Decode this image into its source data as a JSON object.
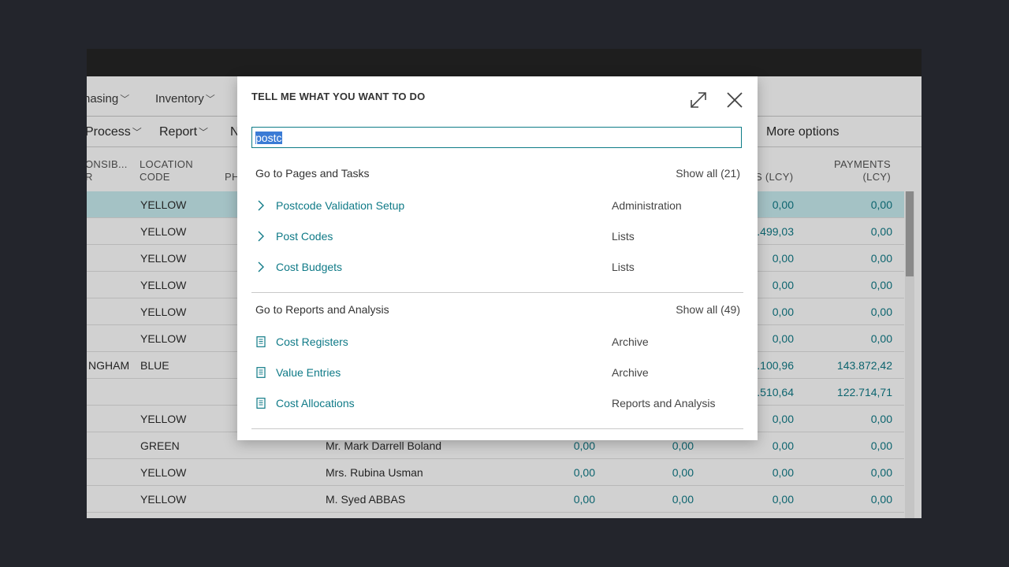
{
  "menu_row": [
    {
      "label": "hasing"
    },
    {
      "label": "Inventory"
    }
  ],
  "action_row": {
    "process": "Process",
    "report": "Report",
    "n_partial": "N",
    "more_options": "More options"
  },
  "columns": {
    "responsible": "ONSIB...\nR",
    "location_code": "LOCATION\nCODE",
    "phone_partial": "PH",
    "sales_partial": "S (LCY)",
    "payments": "PAYMENTS\n(LCY)"
  },
  "rows": [
    {
      "responsible": "",
      "location": "YELLOW",
      "contact": "",
      "c1": "",
      "c2": "",
      "c3": "0,00",
      "payments": "0,00",
      "selected": true
    },
    {
      "responsible": "",
      "location": "YELLOW",
      "contact": "",
      "c1": "",
      "c2": "",
      "c3": ".499,03",
      "payments": "0,00"
    },
    {
      "responsible": "",
      "location": "YELLOW",
      "contact": "",
      "c1": "",
      "c2": "",
      "c3": "0,00",
      "payments": "0,00"
    },
    {
      "responsible": "",
      "location": "YELLOW",
      "contact": "",
      "c1": "",
      "c2": "",
      "c3": "0,00",
      "payments": "0,00"
    },
    {
      "responsible": "",
      "location": "YELLOW",
      "contact": "",
      "c1": "",
      "c2": "",
      "c3": "0,00",
      "payments": "0,00"
    },
    {
      "responsible": "",
      "location": "YELLOW",
      "contact": "",
      "c1": "",
      "c2": "",
      "c3": "0,00",
      "payments": "0,00"
    },
    {
      "responsible": "NGHAM",
      "location": "BLUE",
      "contact": "",
      "c1": "",
      "c2": "",
      "c3": ".100,96",
      "payments": "143.872,42"
    },
    {
      "responsible": "",
      "location": "",
      "contact": "",
      "c1": "",
      "c2": "",
      "c3": ".510,64",
      "payments": "122.714,71"
    },
    {
      "responsible": "",
      "location": "YELLOW",
      "contact": "",
      "c1": "",
      "c2": "",
      "c3": "0,00",
      "payments": "0,00"
    },
    {
      "responsible": "",
      "location": "GREEN",
      "contact": "Mr. Mark Darrell Boland",
      "c1": "0,00",
      "c2": "0,00",
      "c3": "0,00",
      "payments": "0,00"
    },
    {
      "responsible": "",
      "location": "YELLOW",
      "contact": "Mrs. Rubina Usman",
      "c1": "0,00",
      "c2": "0,00",
      "c3": "0,00",
      "payments": "0,00"
    },
    {
      "responsible": "",
      "location": "YELLOW",
      "contact": "M. Syed ABBAS",
      "c1": "0,00",
      "c2": "0,00",
      "c3": "0,00",
      "payments": "0,00"
    }
  ],
  "dialog": {
    "title": "TELL ME WHAT YOU WANT TO DO",
    "search_value": "postc",
    "pages_section": {
      "title": "Go to Pages and Tasks",
      "show_all": "Show all (21)",
      "items": [
        {
          "label": "Postcode Validation Setup",
          "category": "Administration",
          "icon": "chevron-right-icon"
        },
        {
          "label": "Post Codes",
          "category": "Lists",
          "icon": "chevron-right-icon"
        },
        {
          "label": "Cost Budgets",
          "category": "Lists",
          "icon": "chevron-right-icon"
        }
      ]
    },
    "reports_section": {
      "title": "Go to Reports and Analysis",
      "show_all": "Show all (49)",
      "items": [
        {
          "label": "Cost Registers",
          "category": "Archive",
          "icon": "report-icon"
        },
        {
          "label": "Value Entries",
          "category": "Archive",
          "icon": "report-icon"
        },
        {
          "label": "Cost Allocations",
          "category": "Reports and Analysis",
          "icon": "report-icon"
        }
      ]
    }
  },
  "colors": {
    "accent": "#0f7a87",
    "selected_row": "#c9edf1",
    "background": "#2b2e36"
  }
}
